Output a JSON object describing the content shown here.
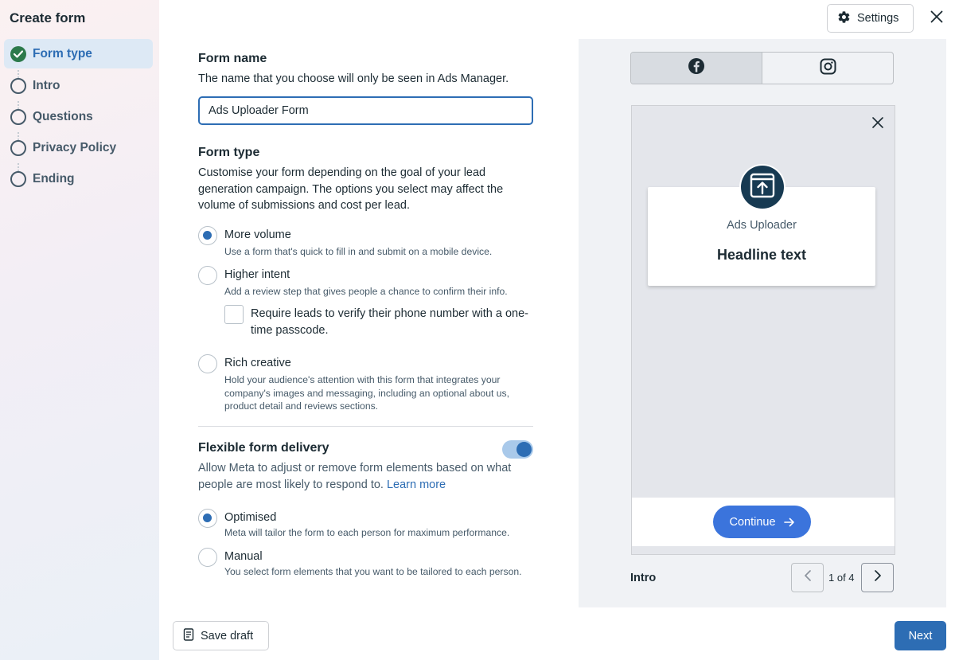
{
  "sidebar": {
    "title": "Create form",
    "steps": [
      {
        "label": "Form type",
        "state": "done"
      },
      {
        "label": "Intro",
        "state": "todo"
      },
      {
        "label": "Questions",
        "state": "todo"
      },
      {
        "label": "Privacy Policy",
        "state": "todo"
      },
      {
        "label": "Ending",
        "state": "todo"
      }
    ]
  },
  "form_name": {
    "title": "Form name",
    "description": "The name that you choose will only be seen in Ads Manager.",
    "value": "Ads Uploader Form"
  },
  "form_type": {
    "title": "Form type",
    "description": "Customise your form depending on the goal of your lead generation campaign. The options you select may affect the volume of submissions and cost per lead.",
    "options": [
      {
        "label": "More volume",
        "sub": "Use a form that's quick to fill in and submit on a mobile device.",
        "selected": true
      },
      {
        "label": "Higher intent",
        "sub": "Add a review step that gives people a chance to confirm their info.",
        "selected": false
      },
      {
        "label": "Rich creative",
        "sub": "Hold your audience's attention with this form that integrates your company's images and messaging, including an optional about us, product detail and reviews sections.",
        "selected": false
      }
    ],
    "verify_checkbox_label": "Require leads to verify their phone number with a one-time passcode.",
    "verify_checked": false
  },
  "flexible_delivery": {
    "title": "Flexible form delivery",
    "description": "Allow Meta to adjust or remove form elements based on what people are most likely to respond to.",
    "learn_more": "Learn more",
    "enabled": true,
    "options": [
      {
        "label": "Optimised",
        "sub": "Meta will tailor the form to each person for maximum performance.",
        "selected": true
      },
      {
        "label": "Manual",
        "sub": "You select form elements that you want to be tailored to each person.",
        "selected": false
      }
    ]
  },
  "footer": {
    "save_draft": "Save draft",
    "next": "Next"
  },
  "header": {
    "settings": "Settings"
  },
  "preview": {
    "platforms": [
      {
        "name": "facebook-icon",
        "selected": true
      },
      {
        "name": "instagram-icon",
        "selected": false
      }
    ],
    "page_name": "Ads Uploader",
    "headline": "Headline text",
    "continue": "Continue",
    "step_label": "Intro",
    "pager": "1 of 4"
  },
  "colors": {
    "accent": "#2d6db4",
    "success": "#2c7a4b",
    "continue_button": "#3b74dc"
  }
}
